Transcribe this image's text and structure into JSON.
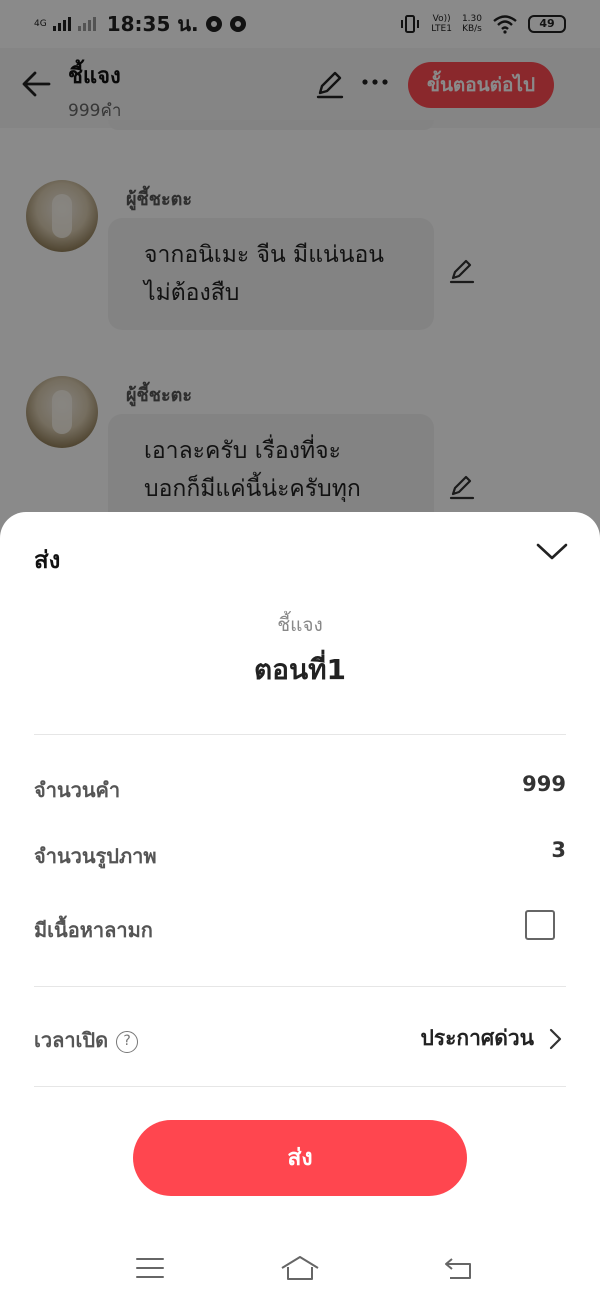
{
  "status_bar": {
    "network": "4G",
    "time": "18:35 น.",
    "volte": "Vo))",
    "lte": "LTE1",
    "speed_value": "1.30",
    "speed_unit": "KB/s",
    "battery": "49"
  },
  "header": {
    "title": "ชี้แจง",
    "subtitle": "999คำ",
    "next_button": "ขั้นตอนต่อไป"
  },
  "messages": [
    {
      "sender": "ผู้ชี้ชะตะ",
      "text_lines": [
        "จากอนิเมะ จีน มีแน่นอน",
        "ไม่ต้องสืบ"
      ]
    },
    {
      "sender": "ผู้ชี้ชะตะ",
      "text_lines": [
        "เอาละครับ เรื่องที่จะ",
        "บอกก็มีแค่นี้น่ะครับทุก"
      ]
    }
  ],
  "sheet": {
    "title": "ส่ง",
    "story_name": "ชี้แจง",
    "chapter_name": "ตอนที่1",
    "word_count_label": "จำนวนคำ",
    "word_count_value": "999",
    "image_count_label": "จำนวนรูปภาพ",
    "image_count_value": "3",
    "adult_label": "มีเนื้อหาลามก",
    "adult_checked": false,
    "open_time_label": "เวลาเปิด",
    "help_symbol": "?",
    "open_time_value": "ประกาศด่วน",
    "send_button": "ส่ง"
  },
  "colors": {
    "accent": "#ff464f",
    "overlay": "rgba(0,0,0,0.46)"
  }
}
